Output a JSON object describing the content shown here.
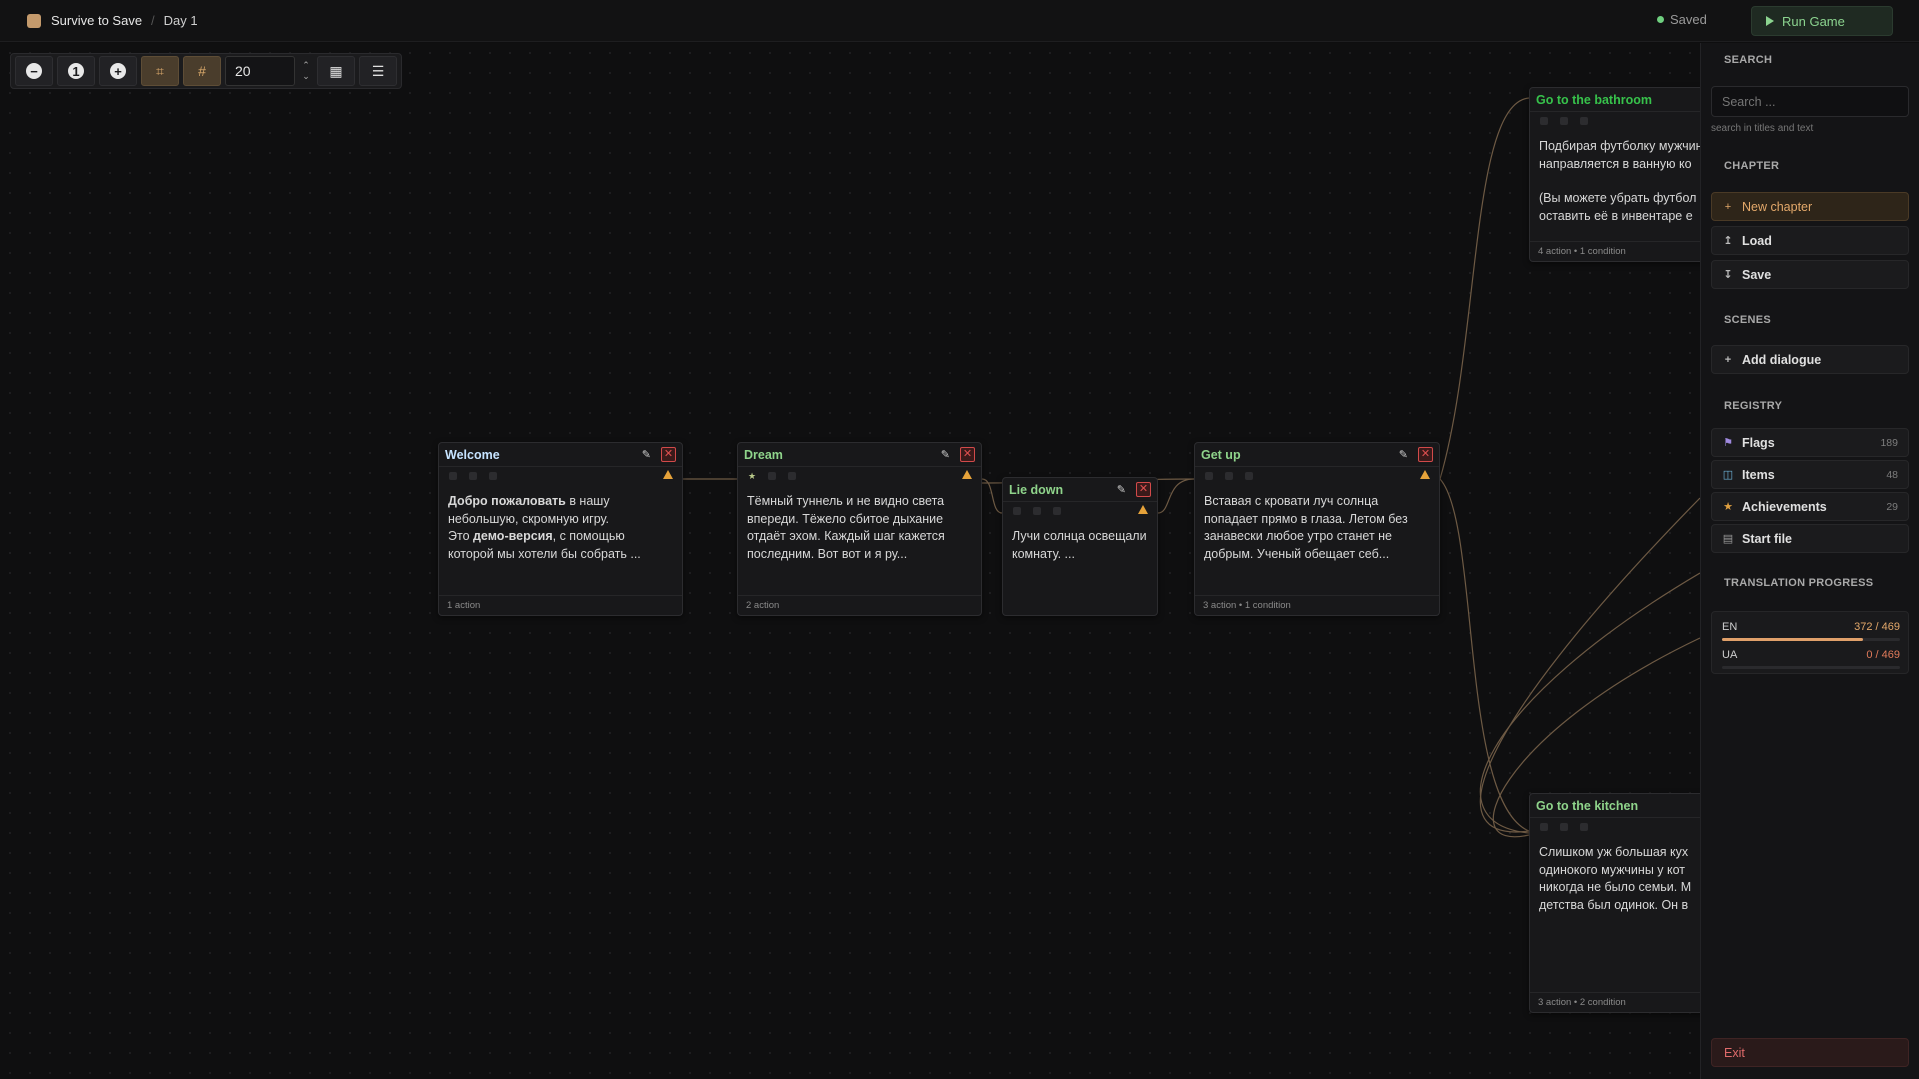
{
  "header": {
    "project": "Survive to Save",
    "breadcrumb_sep": "/",
    "chapter": "Day 1",
    "saved": "Saved",
    "run": "Run Game"
  },
  "toolbar": {
    "grid_size": "20",
    "up": "⌃",
    "down": "⌄"
  },
  "nodes": {
    "welcome": {
      "title": "Welcome",
      "b1": "Добро пожаловать",
      "t1": " в нашу небольшую, скромную игру.",
      "t2": "Это ",
      "b2": "демо-версия",
      "t3": ", с помощью которой мы хотели бы собрать ...",
      "footer": "1 action"
    },
    "dream": {
      "title": "Dream",
      "body": "Тёмный туннель и не видно света впереди. Тёжело сбитое дыхание отдаёт эхом. Каждый шаг кажется последним. Вот вот и я ру...",
      "footer": "2 action"
    },
    "liedown": {
      "title": "Lie down",
      "body": "Лучи солнца освещали комнату. ..."
    },
    "getup": {
      "title": "Get up",
      "body": "Вставая с кровати луч солнца попадает прямо в глаза. Летом без занавески любое утро станет не добрым. Ученый обещает себ...",
      "footer": "3 action • 1 condition"
    },
    "bathroom": {
      "title": "Go to the bathroom",
      "body1": "Подбирая футболку мужчина направляется в ванную ко",
      "body2": "(Вы можете убрать футбол оставить её в инвентаре е",
      "footer": "4 action • 1 condition"
    },
    "kitchen": {
      "title": "Go to the kitchen",
      "body": "Слишком уж большая кух одинокого мужчины у кот никогда не было семьи. М детства был одинок. Он в",
      "footer": "3 action • 2 condition"
    }
  },
  "sidebar": {
    "search_title": "SEARCH",
    "search_placeholder": "Search ...",
    "search_hint": "search in titles and text",
    "chapter_title": "CHAPTER",
    "new_chapter": "New chapter",
    "load": "Load",
    "save": "Save",
    "scenes_title": "SCENES",
    "add_dialogue": "Add dialogue",
    "registry_title": "REGISTRY",
    "flags": "Flags",
    "flags_count": "189",
    "items": "Items",
    "items_count": "48",
    "achievements": "Achievements",
    "achievements_count": "29",
    "start_file": "Start file",
    "translation_title": "TRANSLATION PROGRESS",
    "en": "EN",
    "en_val": "372 / 469",
    "en_done": 372,
    "ua": "UA",
    "ua_val": "0 / 469",
    "ua_done": 0,
    "total": 469,
    "exit": "Exit"
  },
  "colors": {
    "accent": "#e3a86a",
    "saved_dot": "#6fcf7f",
    "danger": "#e05050"
  }
}
